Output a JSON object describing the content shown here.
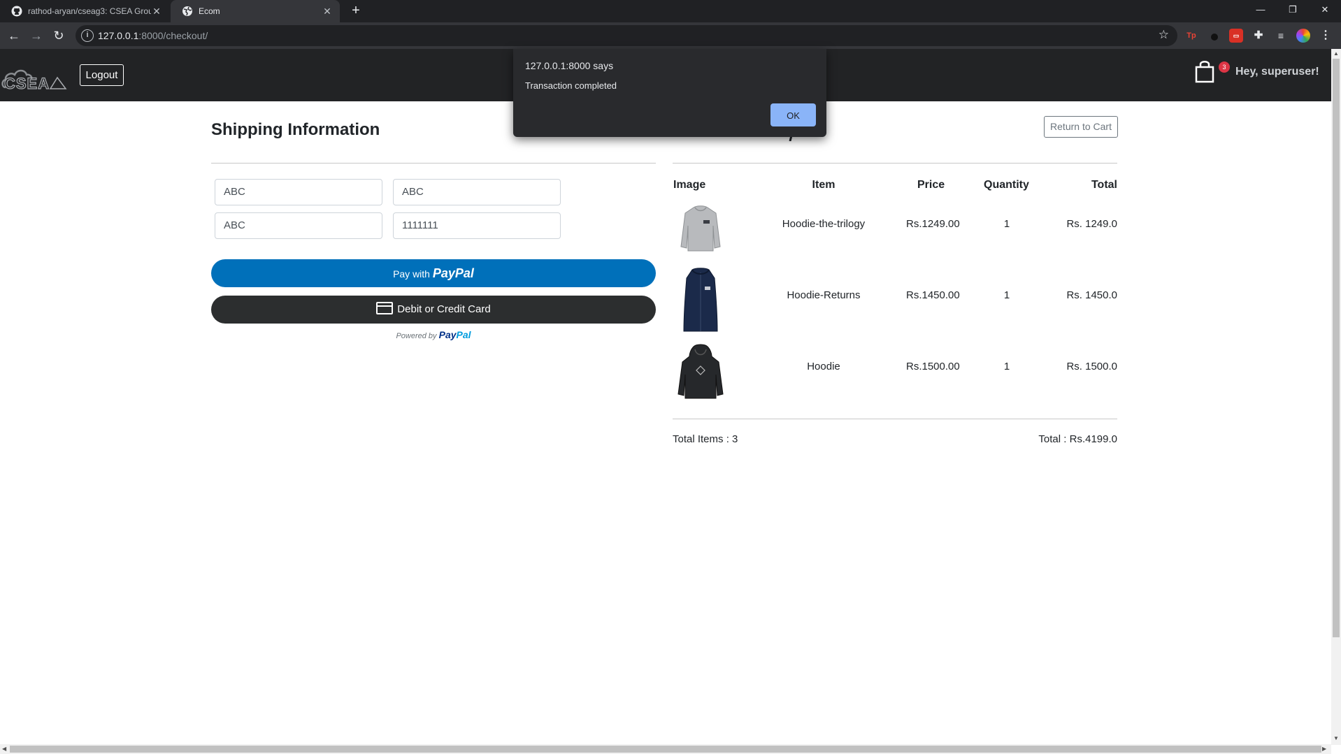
{
  "browser": {
    "tabs": [
      {
        "title": "rathod-aryan/cseag3: CSEA Grou",
        "active": false,
        "icon": "github-icon"
      },
      {
        "title": "Ecom",
        "active": true,
        "icon": "globe-icon"
      }
    ],
    "url_host": "127.0.0.1",
    "url_rest": ":8000/checkout/"
  },
  "navbar": {
    "logout_label": "Logout",
    "cart_count": "3",
    "greeting": "Hey, superuser!"
  },
  "dialog": {
    "title": "127.0.0.1:8000 says",
    "message": "Transaction completed",
    "ok_label": "OK"
  },
  "shipping": {
    "heading": "Shipping Information",
    "fields": [
      "ABC",
      "ABC",
      "ABC",
      "1111111"
    ]
  },
  "payment": {
    "paypal_prefix": "Pay with",
    "paypal_brand": "PayPal",
    "card_label": "Debit or Credit Card",
    "powered_by": "Powered by",
    "powered_brand_a": "Pay",
    "powered_brand_b": "Pal"
  },
  "summary": {
    "return_label": "Return to Cart",
    "headers": {
      "image": "Image",
      "item": "Item",
      "price": "Price",
      "quantity": "Quantity",
      "total": "Total"
    },
    "rows": [
      {
        "item": "Hoodie-the-trilogy",
        "price": "Rs.1249.00",
        "quantity": "1",
        "total": "Rs. 1249.0"
      },
      {
        "item": "Hoodie-Returns",
        "price": "Rs.1450.00",
        "quantity": "1",
        "total": "Rs. 1450.0"
      },
      {
        "item": "Hoodie",
        "price": "Rs.1500.00",
        "quantity": "1",
        "total": "Rs. 1500.0"
      }
    ],
    "total_items": "Total Items : 3",
    "total_price": "Total : Rs.4199.0"
  },
  "colors": {
    "paypal_blue": "#0070ba",
    "card_black": "#2c2e2f",
    "navbar": "#222325",
    "badge_red": "#dc3545",
    "dialog_ok": "#8ab4f8"
  }
}
